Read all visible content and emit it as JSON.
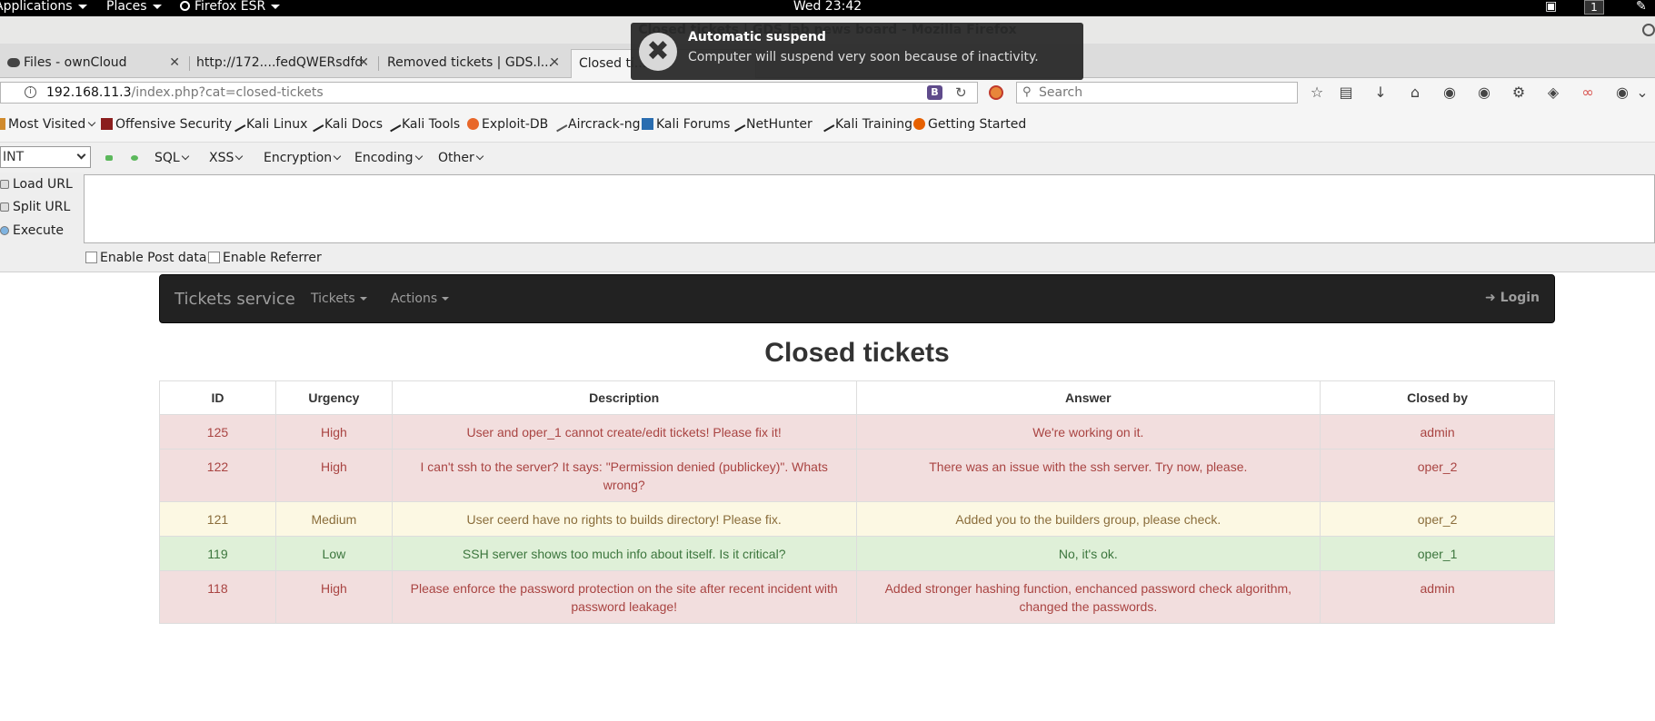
{
  "os_topbar": {
    "applications": "Applications",
    "places": "Places",
    "firefox": "Firefox ESR",
    "clock": "Wed 23:42",
    "workspace": "1"
  },
  "window": {
    "title": "Closed tickets | GDS.lab news board - Mozilla Firefox"
  },
  "tabs": [
    {
      "label": "Files - ownCloud"
    },
    {
      "label": "http://172....fedQWERsdfd"
    },
    {
      "label": "Removed tickets | GDS.l..."
    },
    {
      "label": "Closed ti..."
    }
  ],
  "urlbar": {
    "host": "192.168.11.3",
    "path": "/index.php?cat=closed-tickets"
  },
  "searchbar": {
    "placeholder": "Search"
  },
  "bookmarks": [
    {
      "label": "Most Visited"
    },
    {
      "label": "Offensive Security"
    },
    {
      "label": "Kali Linux"
    },
    {
      "label": "Kali Docs"
    },
    {
      "label": "Kali Tools"
    },
    {
      "label": "Exploit-DB"
    },
    {
      "label": "Aircrack-ng"
    },
    {
      "label": "Kali Forums"
    },
    {
      "label": "NetHunter"
    },
    {
      "label": "Kali Training"
    },
    {
      "label": "Getting Started"
    }
  ],
  "hackbar": {
    "select_value": "INT",
    "menus": [
      "SQL",
      "XSS",
      "Encryption",
      "Encoding",
      "Other"
    ],
    "actions": [
      "Load URL",
      "Split URL",
      "Execute"
    ],
    "checks": [
      "Enable Post data",
      "Enable Referrer"
    ]
  },
  "notification": {
    "title": "Automatic suspend",
    "body": "Computer will suspend very soon because of inactivity."
  },
  "site": {
    "brand": "Tickets service",
    "nav": [
      "Tickets",
      "Actions"
    ],
    "login": "Login"
  },
  "page": {
    "heading": "Closed tickets",
    "columns": [
      "ID",
      "Urgency",
      "Description",
      "Answer",
      "Closed by"
    ],
    "rows": [
      {
        "status": "danger",
        "id": "125",
        "urgency": "High",
        "description": "User and oper_1 cannot create/edit tickets! Please fix it!",
        "answer": "We're working on it.",
        "closed_by": "admin"
      },
      {
        "status": "danger",
        "id": "122",
        "urgency": "High",
        "description": "I can't ssh to the server? It says: \"Permission denied (publickey)\". Whats wrong?",
        "answer": "There was an issue with the ssh server. Try now, please.",
        "closed_by": "oper_2"
      },
      {
        "status": "warning",
        "id": "121",
        "urgency": "Medium",
        "description": "User ceerd have no rights to builds directory! Please fix.",
        "answer": "Added you to the builders group, please check.",
        "closed_by": "oper_2"
      },
      {
        "status": "success",
        "id": "119",
        "urgency": "Low",
        "description": "SSH server shows too much info about itself. Is it critical?",
        "answer": "No, it's ok.",
        "closed_by": "oper_1"
      },
      {
        "status": "danger",
        "id": "118",
        "urgency": "High",
        "description": "Please enforce the password protection on the site after recent incident with password leakage!",
        "answer": "Added stronger hashing function, enchanced password check algorithm, changed the passwords.",
        "closed_by": "admin"
      }
    ]
  },
  "colors": {
    "danger_bg": "#f2dede",
    "warning_bg": "#fcf8e3",
    "success_bg": "#dff0d8",
    "navbar_bg": "#222222"
  }
}
